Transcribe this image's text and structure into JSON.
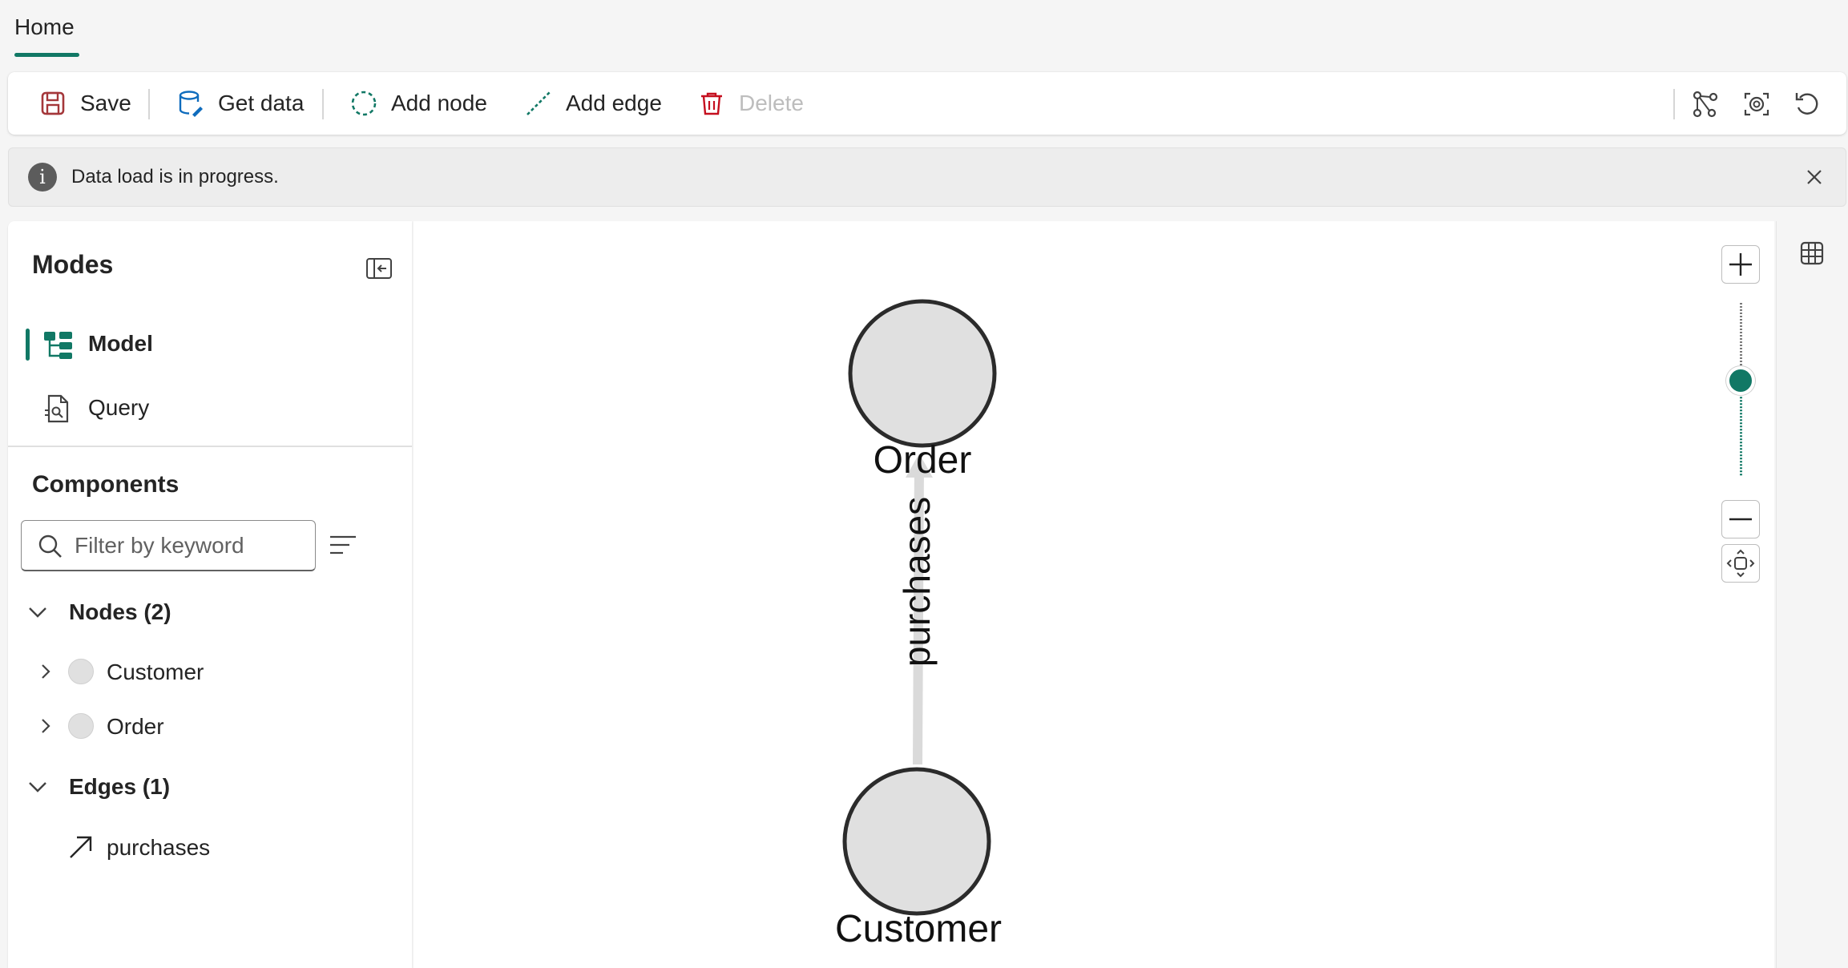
{
  "tabs": {
    "home_label": "Home"
  },
  "toolbar": {
    "save_label": "Save",
    "get_data_label": "Get data",
    "add_node_label": "Add node",
    "add_edge_label": "Add edge",
    "delete_label": "Delete",
    "right_icons": [
      "graph-layout-icon",
      "focus-icon",
      "undo-icon"
    ]
  },
  "message": {
    "text": "Data load is in progress."
  },
  "left_panel": {
    "modes_title": "Modes",
    "modes": [
      {
        "label": "Model",
        "icon": "model-icon",
        "selected": true
      },
      {
        "label": "Query",
        "icon": "query-icon",
        "selected": false
      }
    ],
    "components_title": "Components",
    "search": {
      "placeholder": "Filter by keyword",
      "value": ""
    },
    "nodes_group": "Nodes (2)",
    "nodes": [
      "Customer",
      "Order"
    ],
    "edges_group": "Edges (1)",
    "edges": [
      "purchases"
    ]
  },
  "graph": {
    "nodes": [
      "Order",
      "Customer"
    ],
    "edge": {
      "label": "purchases",
      "from": "Customer",
      "to": "Order"
    },
    "node_fill": "#e0e0e0",
    "node_stroke": "#2b2b2b",
    "edge_color": "#dadada",
    "zoom_level": 0.55
  },
  "colors": {
    "accent": "#117865"
  }
}
